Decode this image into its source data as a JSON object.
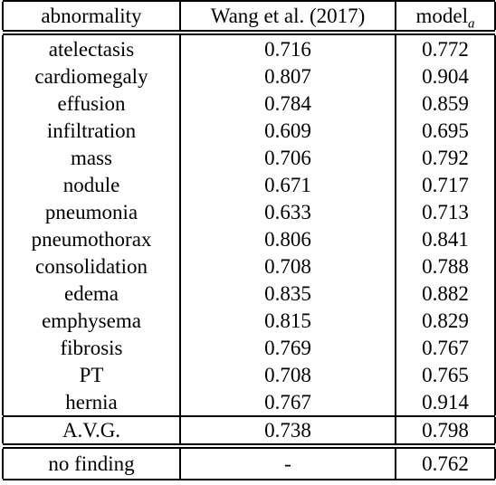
{
  "table": {
    "columns": [
      {
        "key": "abnormality",
        "label": "abnormality"
      },
      {
        "key": "baseline",
        "label": "Wang et al. (2017)"
      },
      {
        "key": "model",
        "label_base": "model",
        "label_sub": "a"
      }
    ],
    "rows": [
      {
        "abnormality": "atelectasis",
        "baseline": "0.716",
        "model": "0.772",
        "model_bold": true
      },
      {
        "abnormality": "cardiomegaly",
        "baseline": "0.807",
        "model": "0.904",
        "model_bold": true
      },
      {
        "abnormality": "effusion",
        "baseline": "0.784",
        "model": "0.859",
        "model_bold": true
      },
      {
        "abnormality": "infiltration",
        "baseline": "0.609",
        "model": "0.695",
        "model_bold": true
      },
      {
        "abnormality": "mass",
        "baseline": "0.706",
        "model": "0.792",
        "model_bold": true
      },
      {
        "abnormality": "nodule",
        "baseline": "0.671",
        "model": "0.717",
        "model_bold": true
      },
      {
        "abnormality": "pneumonia",
        "baseline": "0.633",
        "model": "0.713",
        "model_bold": true
      },
      {
        "abnormality": "pneumothorax",
        "baseline": "0.806",
        "model": "0.841",
        "model_bold": true
      },
      {
        "abnormality": "consolidation",
        "baseline": "0.708",
        "model": "0.788",
        "model_bold": true
      },
      {
        "abnormality": "edema",
        "baseline": "0.835",
        "model": "0.882",
        "model_bold": true
      },
      {
        "abnormality": "emphysema",
        "baseline": "0.815",
        "model": "0.829",
        "model_bold": true
      },
      {
        "abnormality": "fibrosis",
        "baseline": "0.769",
        "model": "0.767",
        "model_bold": false
      },
      {
        "abnormality": "PT",
        "baseline": "0.708",
        "model": "0.765",
        "model_bold": true
      },
      {
        "abnormality": "hernia",
        "baseline": "0.767",
        "model": "0.914",
        "model_bold": true
      }
    ],
    "average_row": {
      "abnormality": "A.V.G.",
      "baseline": "0.738",
      "model": "0.798",
      "model_bold": true
    },
    "extra_row": {
      "abnormality": "no finding",
      "baseline": "-",
      "model": "0.762",
      "model_bold": false
    }
  },
  "chart_data": {
    "type": "table",
    "title": "",
    "categories": [
      "atelectasis",
      "cardiomegaly",
      "effusion",
      "infiltration",
      "mass",
      "nodule",
      "pneumonia",
      "pneumothorax",
      "consolidation",
      "edema",
      "emphysema",
      "fibrosis",
      "PT",
      "hernia",
      "A.V.G.",
      "no finding"
    ],
    "series": [
      {
        "name": "Wang et al. (2017)",
        "values": [
          0.716,
          0.807,
          0.784,
          0.609,
          0.706,
          0.671,
          0.633,
          0.806,
          0.708,
          0.835,
          0.815,
          0.769,
          0.708,
          0.767,
          0.738,
          null
        ]
      },
      {
        "name": "model_a",
        "values": [
          0.772,
          0.904,
          0.859,
          0.695,
          0.792,
          0.717,
          0.713,
          0.841,
          0.788,
          0.882,
          0.829,
          0.767,
          0.765,
          0.914,
          0.798,
          0.762
        ]
      }
    ],
    "xlabel": "abnormality",
    "ylabel": "",
    "grid": false,
    "legend": "none"
  }
}
